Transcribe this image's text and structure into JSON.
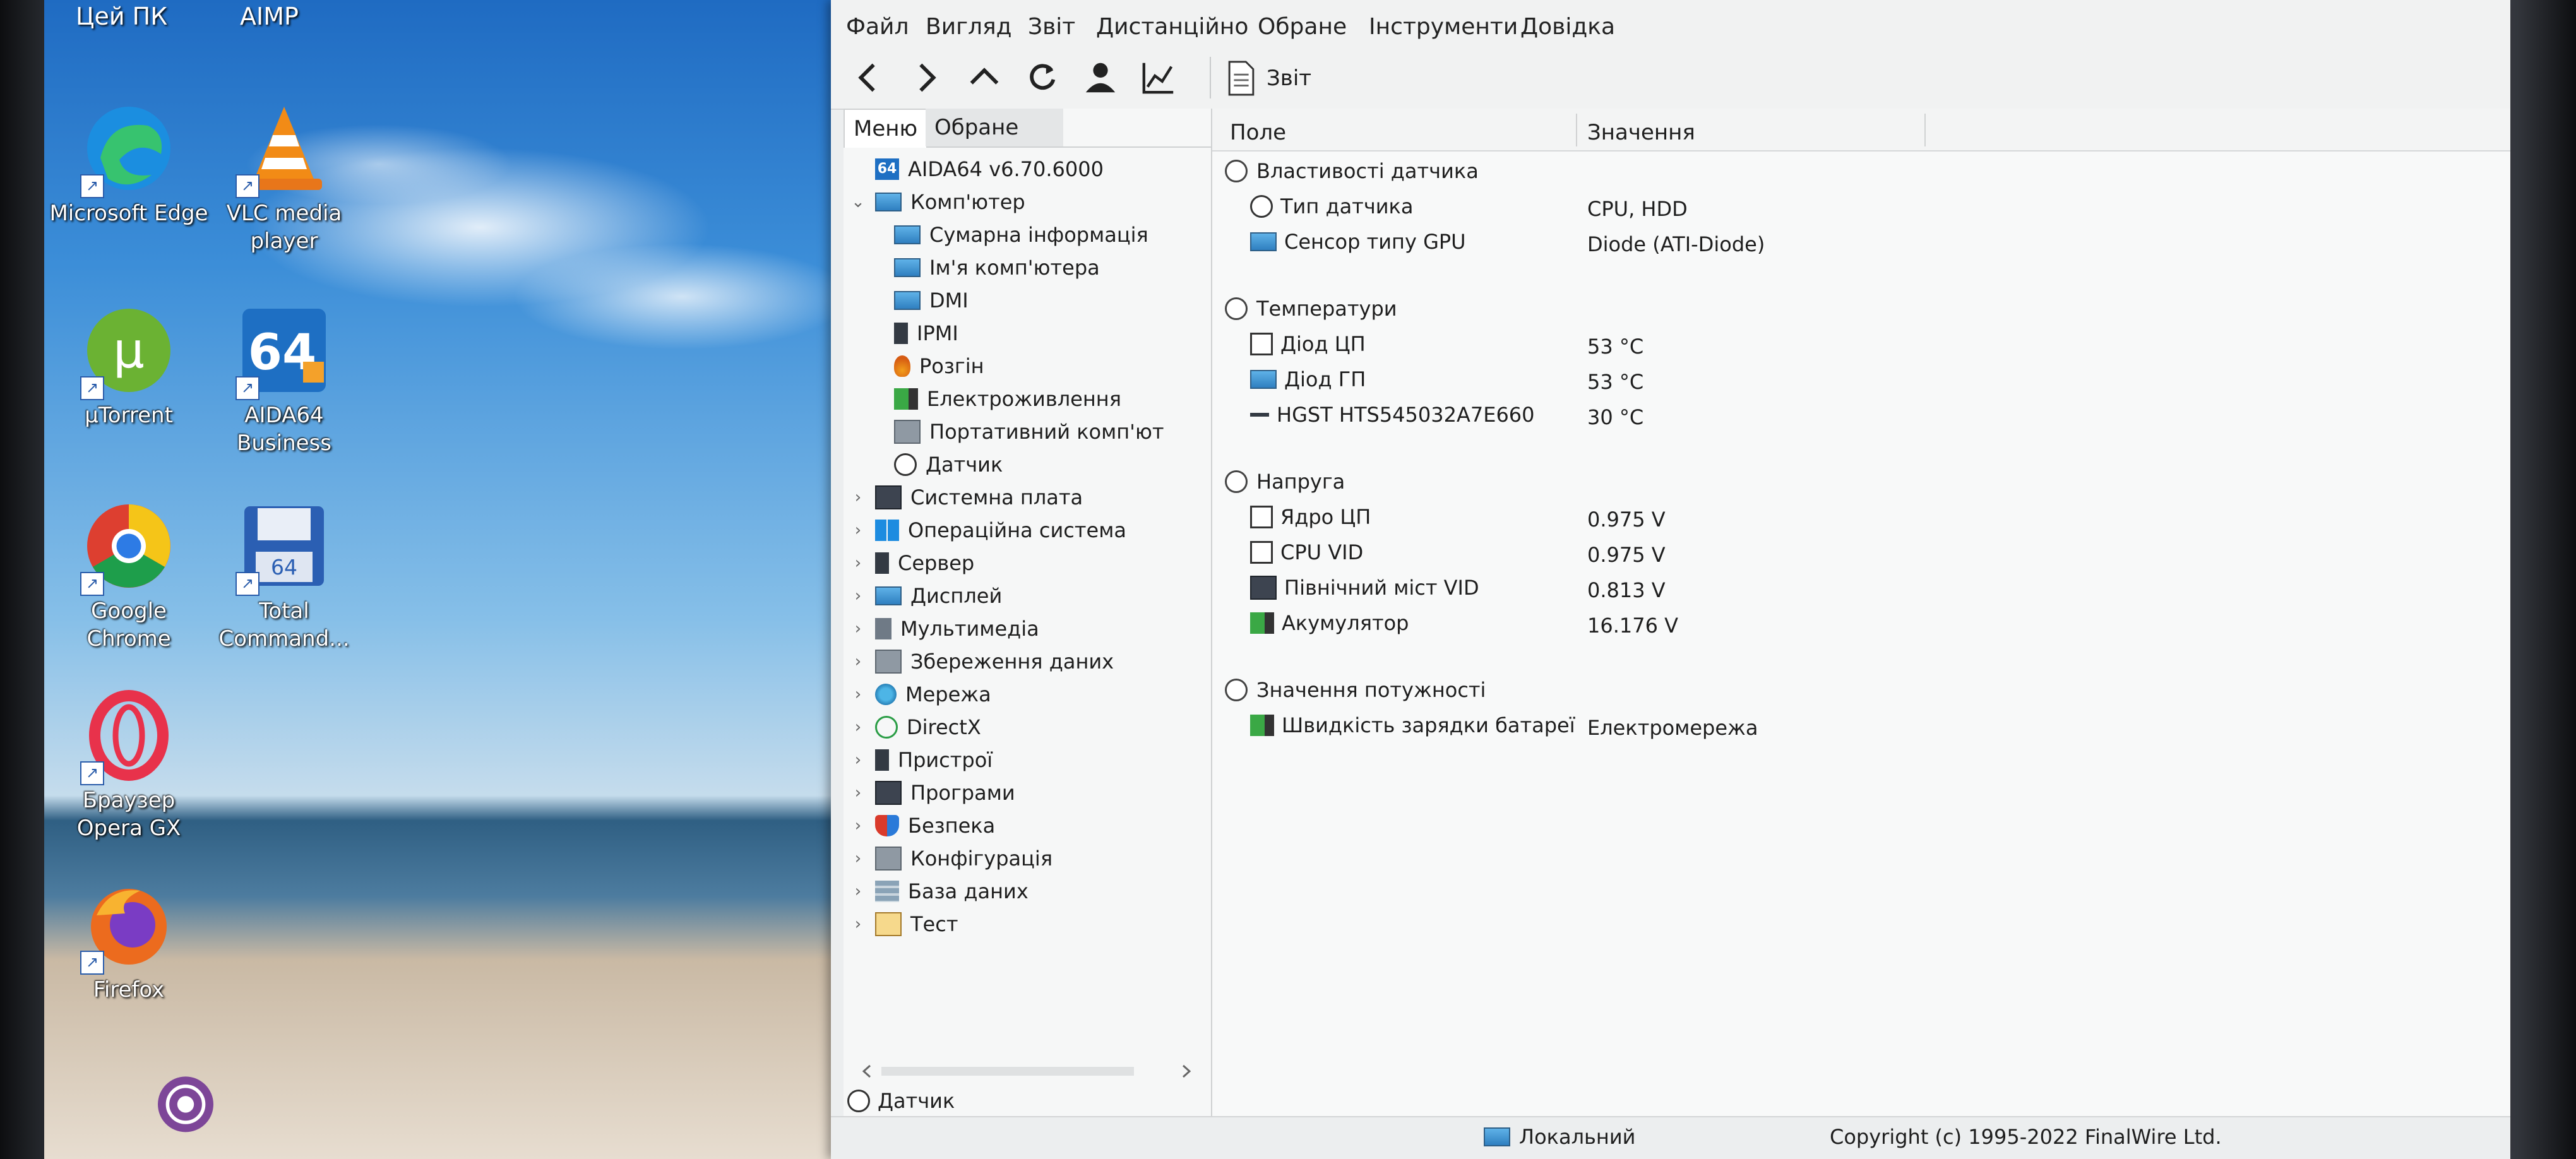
{
  "desktop": {
    "top_labels": [
      "Цей ПК",
      "AIMP"
    ],
    "icons": [
      {
        "label": "Microsoft Edge",
        "icon": "edge-icon",
        "color": "#1b8ee0"
      },
      {
        "label": "VLC media player",
        "icon": "vlc-icon",
        "color": "#f28b16"
      },
      {
        "label": "µTorrent",
        "icon": "utorrent-icon",
        "color": "#6bb233"
      },
      {
        "label": "AIDA64 Business",
        "icon": "aida64-icon",
        "color": "#1e6fc3"
      },
      {
        "label": "Google Chrome",
        "icon": "chrome-icon",
        "color": "#dd3f30"
      },
      {
        "label": "Total Command...",
        "icon": "totalcommander-icon",
        "color": "#2b5fb3"
      },
      {
        "label": "Браузер Opera GX",
        "icon": "opera-gx-icon",
        "color": "#e8324b"
      },
      {
        "label": "Firefox",
        "icon": "firefox-icon",
        "color": "#ec6b1e"
      },
      {
        "label": "",
        "icon": "tor-browser-icon",
        "color": "#7d4698"
      }
    ]
  },
  "menu": [
    "Файл",
    "Вигляд",
    "Звіт",
    "Дистанційно",
    "Обране",
    "Інструменти",
    "Довідка"
  ],
  "toolbar": {
    "buttons": [
      "back-icon",
      "forward-icon",
      "up-icon",
      "refresh-icon",
      "user-icon",
      "chart-icon"
    ],
    "report_label": "Звіт"
  },
  "left_pane": {
    "tabs": [
      "Меню",
      "Обране"
    ],
    "tree": [
      {
        "label": "AIDA64 v6.70.6000",
        "icon": "aida",
        "level": 0,
        "exp": ""
      },
      {
        "label": "Комп'ютер",
        "icon": "monitor",
        "level": 0,
        "exp": "⌄"
      },
      {
        "label": "Сумарна інформація",
        "icon": "monitor",
        "level": 1,
        "exp": ""
      },
      {
        "label": "Ім'я комп'ютера",
        "icon": "monitor",
        "level": 1,
        "exp": ""
      },
      {
        "label": "DMI",
        "icon": "monitor",
        "level": 1,
        "exp": ""
      },
      {
        "label": "IPMI",
        "icon": "dark",
        "level": 1,
        "exp": ""
      },
      {
        "label": "Розгін",
        "icon": "flame",
        "level": 1,
        "exp": ""
      },
      {
        "label": "Електроживлення",
        "icon": "green",
        "level": 1,
        "exp": ""
      },
      {
        "label": "Портативний комп'ют",
        "icon": "grey",
        "level": 1,
        "exp": ""
      },
      {
        "label": "Датчик",
        "icon": "gauge",
        "level": 1,
        "exp": ""
      },
      {
        "label": "Системна плата",
        "icon": "board",
        "level": 0,
        "exp": "›"
      },
      {
        "label": "Операційна система",
        "icon": "win",
        "level": 0,
        "exp": "›"
      },
      {
        "label": "Сервер",
        "icon": "dark",
        "level": 0,
        "exp": "›"
      },
      {
        "label": "Дисплей",
        "icon": "monitor",
        "level": 0,
        "exp": "›"
      },
      {
        "label": "Мультимедіа",
        "icon": "speaker",
        "level": 0,
        "exp": "›"
      },
      {
        "label": "Збереження даних",
        "icon": "grey",
        "level": 0,
        "exp": "›"
      },
      {
        "label": "Мережа",
        "icon": "net",
        "level": 0,
        "exp": "›"
      },
      {
        "label": "DirectX",
        "icon": "x",
        "level": 0,
        "exp": "›"
      },
      {
        "label": "Пристрої",
        "icon": "dark",
        "level": 0,
        "exp": "›"
      },
      {
        "label": "Програми",
        "icon": "board",
        "level": 0,
        "exp": "›"
      },
      {
        "label": "Безпека",
        "icon": "shield",
        "level": 0,
        "exp": "›"
      },
      {
        "label": "Конфігурація",
        "icon": "grey",
        "level": 0,
        "exp": "›"
      },
      {
        "label": "База даних",
        "icon": "db",
        "level": 0,
        "exp": "›"
      },
      {
        "label": "Тест",
        "icon": "report",
        "level": 0,
        "exp": "›"
      }
    ],
    "status": "Датчик"
  },
  "right_pane": {
    "columns": [
      "Поле",
      "Значення"
    ],
    "groups": [
      {
        "title": "Властивості датчика",
        "rows": [
          {
            "field": "Тип датчика",
            "value": "CPU, HDD",
            "icon": "gauge"
          },
          {
            "field": "Сенсор типу GPU",
            "value": "Diode  (ATI-Diode)",
            "icon": "monitor"
          }
        ]
      },
      {
        "title": "Температури",
        "rows": [
          {
            "field": "Діод ЦП",
            "value": "53 °C",
            "icon": "sq"
          },
          {
            "field": "Діод ГП",
            "value": "53 °C",
            "icon": "monitor"
          },
          {
            "field": "HGST HTS545032A7E660",
            "value": "30 °C",
            "icon": "dash"
          }
        ]
      },
      {
        "title": "Напруга",
        "rows": [
          {
            "field": "Ядро ЦП",
            "value": "0.975 V",
            "icon": "sq"
          },
          {
            "field": "CPU VID",
            "value": "0.975 V",
            "icon": "sq"
          },
          {
            "field": "Північний міст VID",
            "value": "0.813 V",
            "icon": "board"
          },
          {
            "field": "Акумулятор",
            "value": "16.176 V",
            "icon": "green"
          }
        ]
      },
      {
        "title": "Значення потужності",
        "rows": [
          {
            "field": "Швидкість зарядки батареї",
            "value": "Електромережа",
            "icon": "green"
          }
        ]
      }
    ]
  },
  "statusbar": {
    "local": "Локальний",
    "copyright": "Copyright (c) 1995-2022 FinalWire Ltd."
  }
}
